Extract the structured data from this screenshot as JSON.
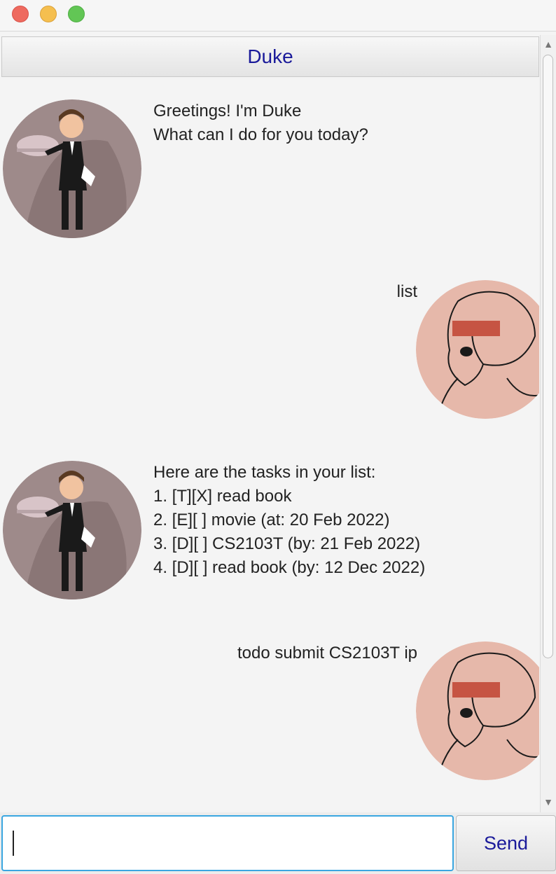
{
  "window": {
    "title": "Duke"
  },
  "conversation": [
    {
      "speaker": "duke",
      "text": "Greetings! I'm Duke\nWhat can I do for you today?"
    },
    {
      "speaker": "user",
      "text": "list"
    },
    {
      "speaker": "duke",
      "text": "Here are the tasks in your list:\n1. [T][X] read book\n2. [E][ ] movie (at: 20 Feb 2022)\n3. [D][ ] CS2103T (by: 21 Feb 2022)\n4. [D][ ] read book (by: 12 Dec 2022)"
    },
    {
      "speaker": "user",
      "text": "todo submit CS2103T ip"
    }
  ],
  "input": {
    "value": "",
    "placeholder": ""
  },
  "send_button": {
    "label": "Send"
  },
  "icons": {
    "duke_avatar": "butler-avatar-icon",
    "user_avatar": "woman-avatar-icon",
    "scroll_up": "chevron-up-icon",
    "scroll_down": "chevron-down-icon"
  },
  "colors": {
    "title_text": "#1a1a9a",
    "input_focus_border": "#3aa6e0",
    "duke_avatar_bg": "#9e8a8a",
    "user_avatar_bg": "#e6b8aa",
    "user_avatar_band": "#c65443"
  }
}
